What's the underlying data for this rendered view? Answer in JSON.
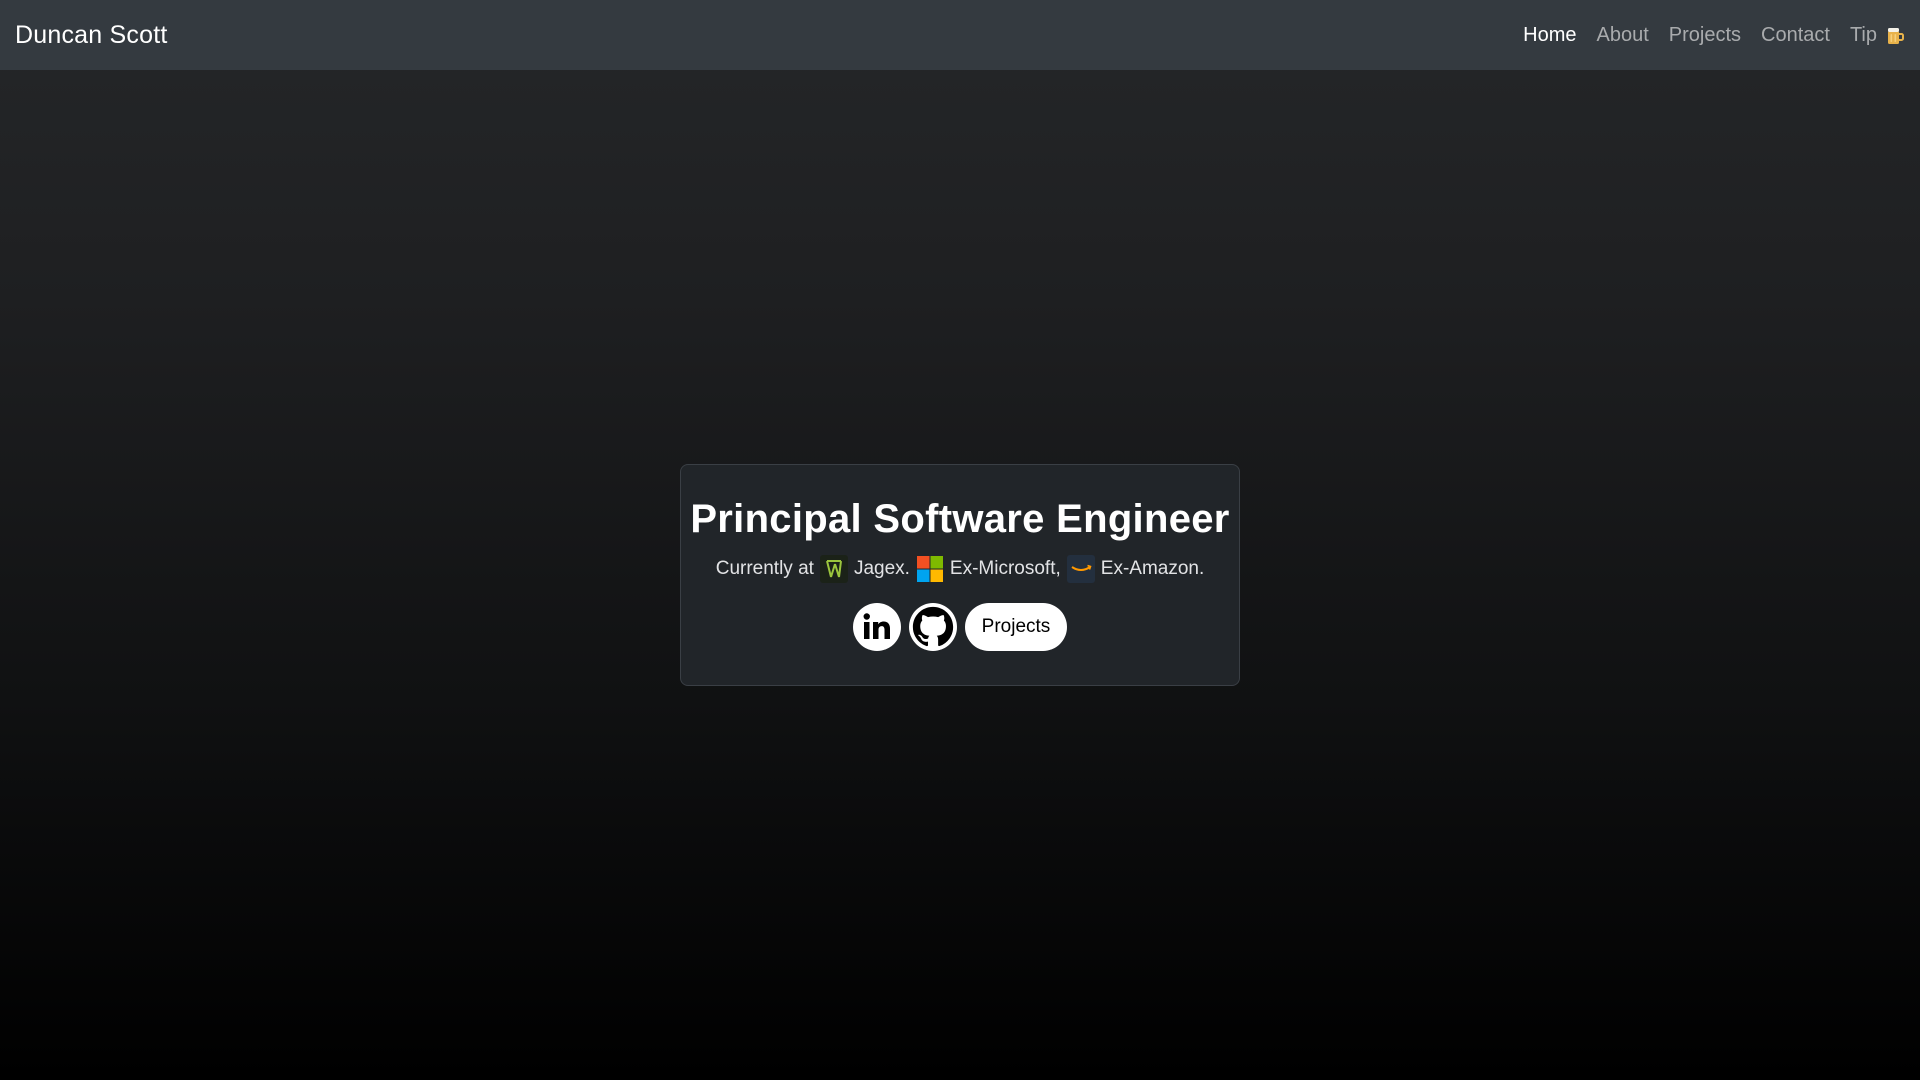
{
  "navbar": {
    "brand": "Duncan Scott",
    "links": [
      {
        "label": "Home",
        "active": true
      },
      {
        "label": "About",
        "active": false
      },
      {
        "label": "Projects",
        "active": false
      },
      {
        "label": "Contact",
        "active": false
      },
      {
        "label": "Tip",
        "active": false,
        "icon": "beer-icon"
      }
    ]
  },
  "hero": {
    "title": "Principal Software Engineer",
    "subtitle": {
      "prefix": "Currently at",
      "current_company": "Jagex.",
      "current_icon": "jagex-logo-icon",
      "past_1": "Ex-Microsoft,",
      "past_1_icon": "microsoft-logo-icon",
      "past_2": "Ex-Amazon.",
      "past_2_icon": "amazon-logo-icon"
    },
    "buttons": {
      "linkedin_icon": "linkedin-icon",
      "github_icon": "github-icon",
      "projects_label": "Projects"
    }
  },
  "colors": {
    "navbar_bg": "#343a40",
    "card_bg": "#212529",
    "nav_active": "#ffffff",
    "nav_inactive": "#a9abad",
    "jagex_green": "#9bc53d",
    "amazon_orange": "#ff9900"
  }
}
